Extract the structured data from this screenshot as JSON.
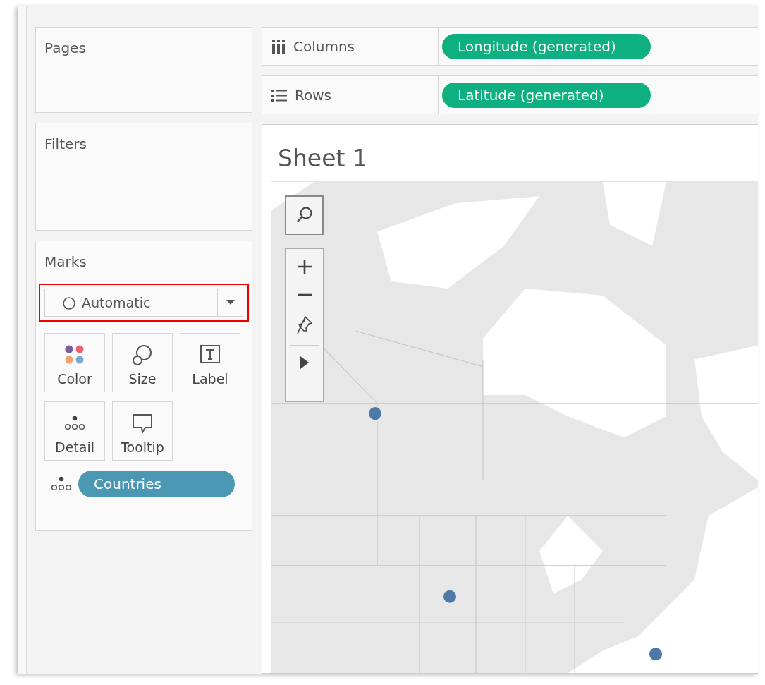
{
  "cards": [
    {
      "title": "Pages"
    },
    {
      "title": "Filters"
    }
  ],
  "marks": {
    "title": "Marks",
    "mark_type": "Automatic",
    "highlighted": true,
    "buttons": [
      {
        "label": "Color",
        "kind": "color"
      },
      {
        "label": "Size",
        "kind": "size"
      },
      {
        "label": "Label",
        "kind": "label"
      },
      {
        "label": "Detail",
        "kind": "detail"
      },
      {
        "label": "Tooltip",
        "kind": "tooltip"
      }
    ],
    "pills": [
      {
        "label": "Countries",
        "kind": "detail"
      }
    ]
  },
  "shelves": [
    {
      "label": "Columns",
      "kind": "columns",
      "pill": "Longitude (generated)"
    },
    {
      "label": "Rows",
      "kind": "rows",
      "pill": "Latitude (generated)"
    }
  ],
  "sheet": {
    "title": "Sheet 1"
  }
}
